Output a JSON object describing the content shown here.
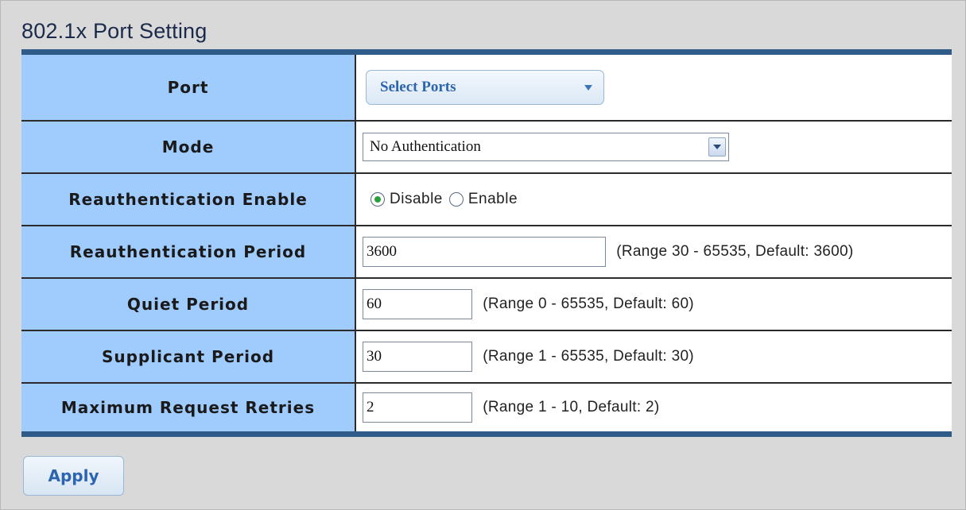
{
  "page_title": "802.1x Port Setting",
  "rows": {
    "port": {
      "label": "Port",
      "dropdown_label": "Select Ports"
    },
    "mode": {
      "label": "Mode",
      "value": "No Authentication"
    },
    "reauth_enable": {
      "label": "Reauthentication Enable",
      "options": [
        "Disable",
        "Enable"
      ],
      "selected": "Disable"
    },
    "reauth_period": {
      "label": "Reauthentication Period",
      "value": "3600",
      "hint": "(Range 30 - 65535, Default: 3600)"
    },
    "quiet_period": {
      "label": "Quiet Period",
      "value": "60",
      "hint": "(Range 0 - 65535, Default: 60)"
    },
    "supplicant_period": {
      "label": "Supplicant Period",
      "value": "30",
      "hint": "(Range 1 - 65535, Default: 30)"
    },
    "max_retries": {
      "label": "Maximum Request Retries",
      "value": "2",
      "hint": "(Range 1 - 10, Default: 2)"
    }
  },
  "apply_label": "Apply",
  "icons": {
    "dropdown": "chevron-down-icon",
    "radio": "radio-button-icon"
  },
  "colors": {
    "label_bg": "#9fcbfd",
    "table_band": "#2f5b88",
    "button_text": "#2c64b0",
    "page_bg": "#d9d9d9"
  }
}
